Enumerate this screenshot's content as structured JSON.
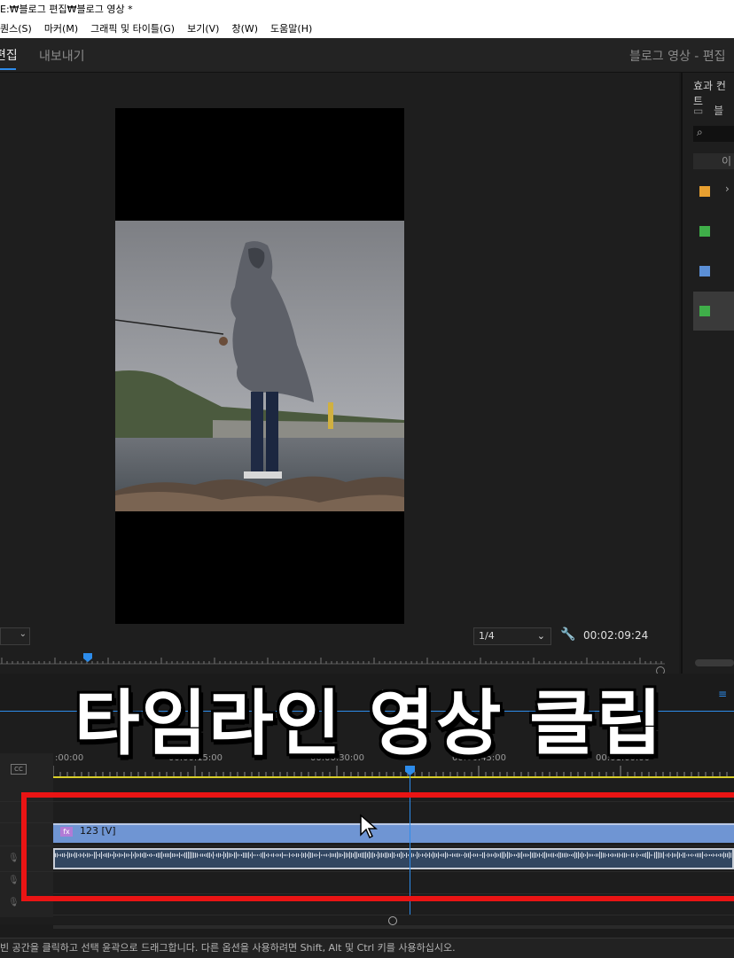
{
  "window": {
    "title": "E:₩블로그 편집₩블로그 영상 *"
  },
  "menu": [
    "퀀스(S)",
    "마커(M)",
    "그래픽 및 타이틀(G)",
    "보기(V)",
    "창(W)",
    "도움말(H)"
  ],
  "workspace": {
    "edit": "편집",
    "export": "내보내기",
    "project": "블로그 영상 - 편집"
  },
  "program_monitor": {
    "resolution": "",
    "ratio": "1/4",
    "timecode": "00:02:09:24"
  },
  "effects_panel": {
    "title": "효과 컨트",
    "folder": "블",
    "search_icon": "search-icon",
    "column_header": "이",
    "rows": [
      {
        "color": "#e8a030",
        "arrow": "›"
      },
      {
        "color": "#3fae49",
        "arrow": ""
      },
      {
        "color": "#5b8fd6",
        "arrow": ""
      },
      {
        "color": "#3fae49",
        "arrow": ""
      }
    ]
  },
  "timeline": {
    "ticks": [
      ":00:00",
      "00:00:15:00",
      "00:00:30:00",
      "00:00:45:00",
      "00:01:00:00"
    ],
    "video_clip": {
      "fx": "fx",
      "label": "123 [V]"
    },
    "accent": "#2d8ceb",
    "highlight_color": "#ea1414"
  },
  "overlay_caption": "타임라인 영상 클립",
  "status": "빈 공간을 클릭하고 선택 윤곽으로 드래그합니다. 다른 옵션을 사용하려면 Shift, Alt 및 Ctrl 키를 사용하십시오."
}
